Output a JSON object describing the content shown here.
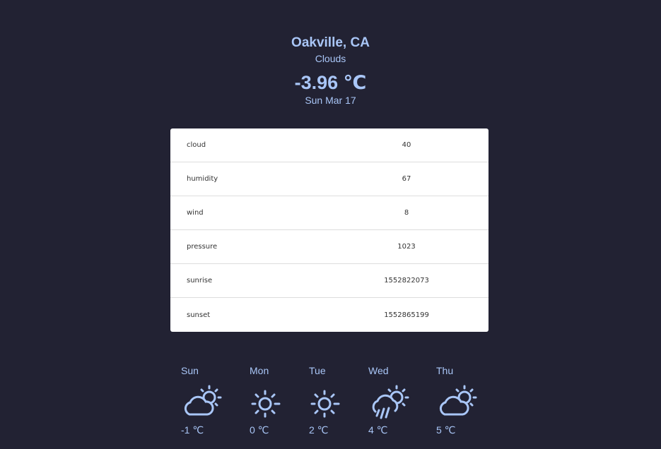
{
  "header": {
    "city": "Oakville, CA",
    "condition": "Clouds",
    "temperature": "-3.96 ℃",
    "date": "Sun Mar 17"
  },
  "details": [
    {
      "label": "cloud",
      "value": "40"
    },
    {
      "label": "humidity",
      "value": "67"
    },
    {
      "label": "wind",
      "value": "8"
    },
    {
      "label": "pressure",
      "value": "1023"
    },
    {
      "label": "sunrise",
      "value": "1552822073"
    },
    {
      "label": "sunset",
      "value": "1552865199"
    }
  ],
  "forecast": [
    {
      "day": "Sun",
      "icon": "partly-cloudy-icon",
      "temp": "-1 ℃"
    },
    {
      "day": "Mon",
      "icon": "sun-icon",
      "temp": "0 ℃"
    },
    {
      "day": "Tue",
      "icon": "sun-icon",
      "temp": "2 ℃"
    },
    {
      "day": "Wed",
      "icon": "rain-cloud-sun-icon",
      "temp": "4 ℃"
    },
    {
      "day": "Thu",
      "icon": "partly-cloudy-icon",
      "temp": "5 ℃"
    }
  ],
  "colors": {
    "background": "#222233",
    "accent": "#a9c6f7",
    "card": "#ffffff"
  }
}
